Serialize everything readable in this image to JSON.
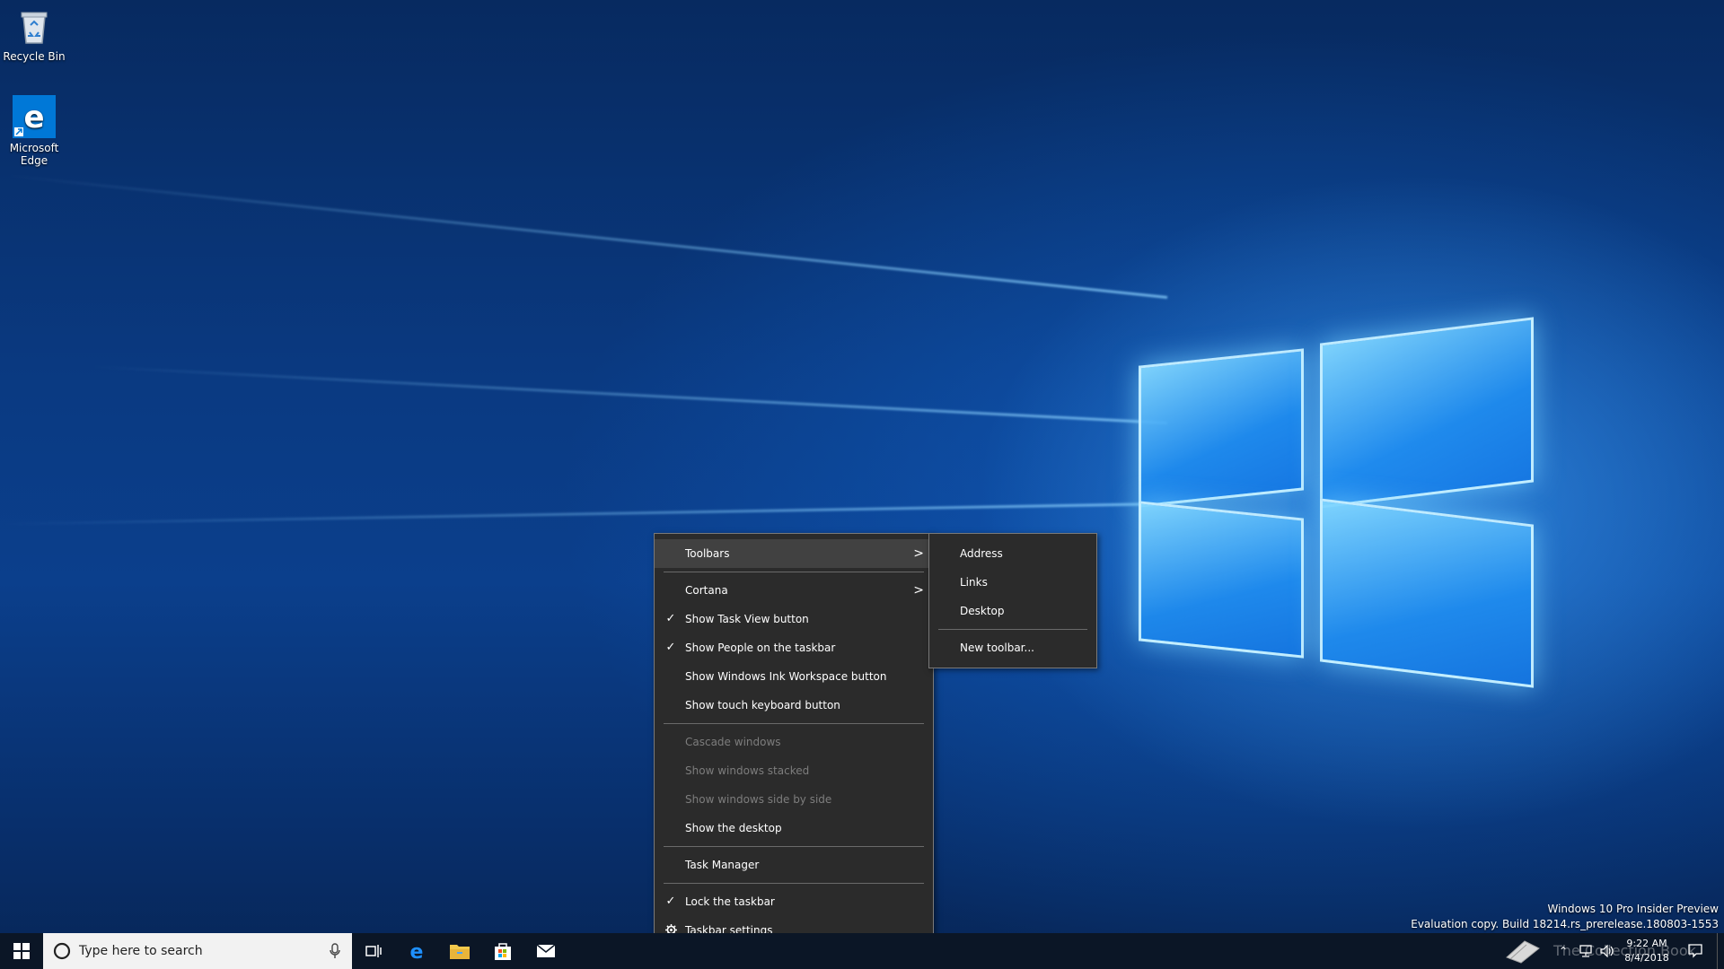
{
  "desktop": {
    "icons": [
      {
        "label": "Recycle Bin",
        "icon": "recycle-bin-icon"
      },
      {
        "label": "Microsoft Edge",
        "icon": "edge-icon"
      }
    ],
    "watermark": {
      "line1": "Windows 10 Pro Insider Preview",
      "line2": "Evaluation copy. Build 18214.rs_prerelease.180803-1553"
    },
    "overlay_text": "The Collection Book"
  },
  "context_menu": {
    "items": [
      {
        "label": "Toolbars",
        "has_submenu": true,
        "highlighted": true
      },
      {
        "label": "Cortana",
        "has_submenu": true
      },
      {
        "label": "Show Task View button",
        "checked": true
      },
      {
        "label": "Show People on the taskbar",
        "checked": true
      },
      {
        "label": "Show Windows Ink Workspace button"
      },
      {
        "label": "Show touch keyboard button"
      },
      {
        "label": "Cascade windows",
        "disabled": true
      },
      {
        "label": "Show windows stacked",
        "disabled": true
      },
      {
        "label": "Show windows side by side",
        "disabled": true
      },
      {
        "label": "Show the desktop"
      },
      {
        "label": "Task Manager"
      },
      {
        "label": "Lock the taskbar",
        "checked": true
      },
      {
        "label": "Taskbar settings",
        "icon": "gear-icon"
      }
    ],
    "check_glyph": "✓",
    "arrow_glyph": ">"
  },
  "toolbars_submenu": {
    "items": [
      "Address",
      "Links",
      "Desktop",
      "New toolbar..."
    ]
  },
  "taskbar": {
    "search_placeholder": "Type here to search",
    "pinned": [
      "task-view-icon",
      "edge-icon",
      "file-explorer-icon",
      "store-icon",
      "mail-icon"
    ],
    "clock_time": "9:22 AM",
    "clock_date": "8/4/2018"
  },
  "colors": {
    "menu_bg": "#2b2b2b",
    "menu_highlight": "#414141",
    "taskbar_bg": "#0b1626",
    "accent_blue": "#0078d7"
  }
}
